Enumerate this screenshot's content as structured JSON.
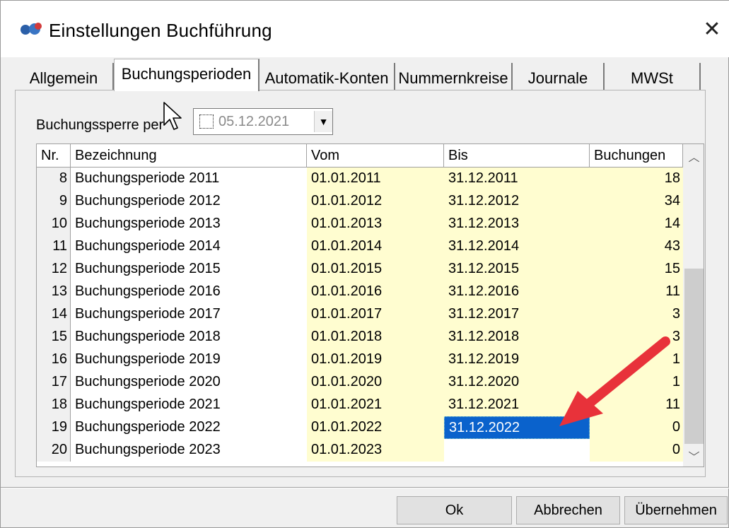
{
  "window": {
    "title": "Einstellungen Buchführung",
    "close_glyph": "✕",
    "app_icon": "app-logo-icon"
  },
  "tabs": [
    {
      "label": "Allgemein",
      "active": false
    },
    {
      "label": "Buchungsperioden",
      "active": true
    },
    {
      "label": "Automatik-Konten",
      "active": false
    },
    {
      "label": "Nummernkreise",
      "active": false
    },
    {
      "label": "Journale",
      "active": false
    },
    {
      "label": "MWSt",
      "active": false
    }
  ],
  "lock": {
    "label": "Buchungssperre per",
    "date": "05.12.2021",
    "checked": false,
    "dropdown_glyph": "▼"
  },
  "grid": {
    "columns": [
      "Nr.",
      "Bezeichnung",
      "Vom",
      "Bis",
      "Buchungen"
    ],
    "rows": [
      {
        "nr": "8",
        "name": "Buchungsperiode 2011",
        "vom": "01.01.2011",
        "bis": "31.12.2011",
        "buchungen": "18"
      },
      {
        "nr": "9",
        "name": "Buchungsperiode 2012",
        "vom": "01.01.2012",
        "bis": "31.12.2012",
        "buchungen": "34"
      },
      {
        "nr": "10",
        "name": "Buchungsperiode 2013",
        "vom": "01.01.2013",
        "bis": "31.12.2013",
        "buchungen": "14"
      },
      {
        "nr": "11",
        "name": "Buchungsperiode 2014",
        "vom": "01.01.2014",
        "bis": "31.12.2014",
        "buchungen": "43"
      },
      {
        "nr": "12",
        "name": "Buchungsperiode 2015",
        "vom": "01.01.2015",
        "bis": "31.12.2015",
        "buchungen": "15"
      },
      {
        "nr": "13",
        "name": "Buchungsperiode 2016",
        "vom": "01.01.2016",
        "bis": "31.12.2016",
        "buchungen": "11"
      },
      {
        "nr": "14",
        "name": "Buchungsperiode 2017",
        "vom": "01.01.2017",
        "bis": "31.12.2017",
        "buchungen": "3"
      },
      {
        "nr": "15",
        "name": "Buchungsperiode 2018",
        "vom": "01.01.2018",
        "bis": "31.12.2018",
        "buchungen": "3"
      },
      {
        "nr": "16",
        "name": "Buchungsperiode 2019",
        "vom": "01.01.2019",
        "bis": "31.12.2019",
        "buchungen": "1"
      },
      {
        "nr": "17",
        "name": "Buchungsperiode 2020",
        "vom": "01.01.2020",
        "bis": "31.12.2020",
        "buchungen": "1"
      },
      {
        "nr": "18",
        "name": "Buchungsperiode 2021",
        "vom": "01.01.2021",
        "bis": "31.12.2021",
        "buchungen": "11"
      },
      {
        "nr": "19",
        "name": "Buchungsperiode 2022",
        "vom": "01.01.2022",
        "bis": "31.12.2022",
        "buchungen": "0",
        "selected": true
      },
      {
        "nr": "20",
        "name": "Buchungsperiode 2023",
        "vom": "01.01.2023",
        "bis": "",
        "buchungen": "0"
      }
    ],
    "scroll_up_glyph": "︿",
    "scroll_down_glyph": "﹀"
  },
  "buttons": {
    "ok": "Ok",
    "cancel": "Abbrechen",
    "apply": "Übernehmen"
  },
  "colors": {
    "editable_cell": "#fffdd0",
    "selection": "#0a62cc",
    "annotation_arrow": "#e8323a"
  }
}
